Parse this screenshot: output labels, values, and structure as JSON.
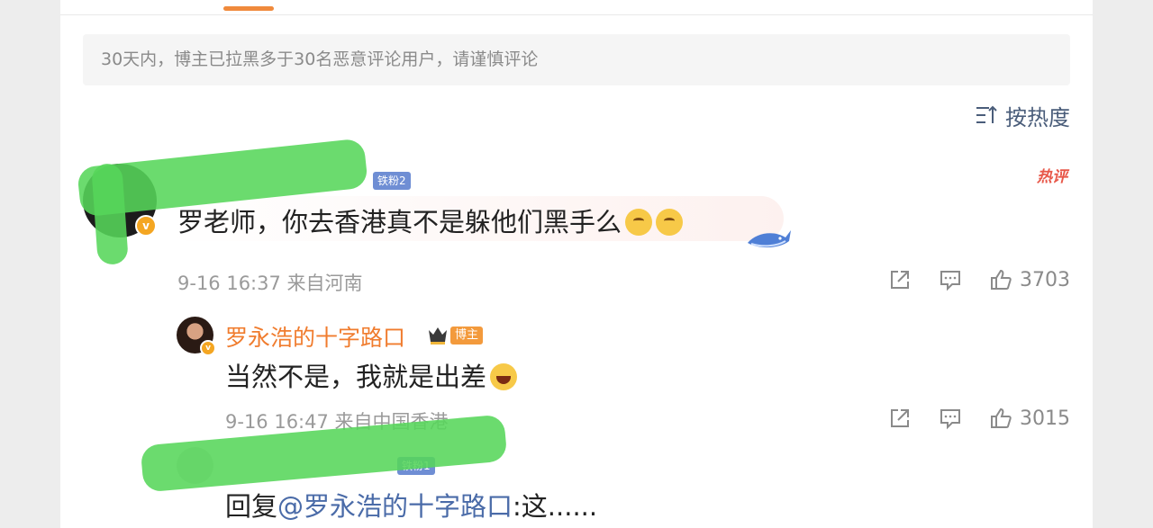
{
  "notice": {
    "text": "30天内，博主已拉黑多于30名恶意评论用户，请谨慎评论"
  },
  "sort": {
    "label": "按热度",
    "icon": "sort-icon"
  },
  "comment": {
    "username": "",
    "fan_badge": "铁粉2",
    "hot_badge": "热评",
    "text": "罗老师，你去香港真不是躲他们黑手么",
    "emojis": [
      "thinking-face-icon",
      "thinking-face-icon"
    ],
    "time": "9-16 16:37",
    "location": "来自河南",
    "like_count": "3703"
  },
  "reply": {
    "username": "罗永浩的十字路口",
    "owner_badge": "博主",
    "text": "当然不是，我就是出差",
    "emoji": "laughing-face-icon",
    "time": "9-16 16:47",
    "location": "来自中国香港",
    "like_count": "3015"
  },
  "reply2": {
    "username": "",
    "fan_badge": "铁粉1",
    "prefix": "回复",
    "mention": "@罗永浩的十字路口",
    "text": ":这......"
  },
  "colors": {
    "accent_orange": "#f07c2e",
    "link_blue": "#4a6ba8",
    "hot_red": "#e8584a",
    "redaction_green": "#57d65a"
  }
}
